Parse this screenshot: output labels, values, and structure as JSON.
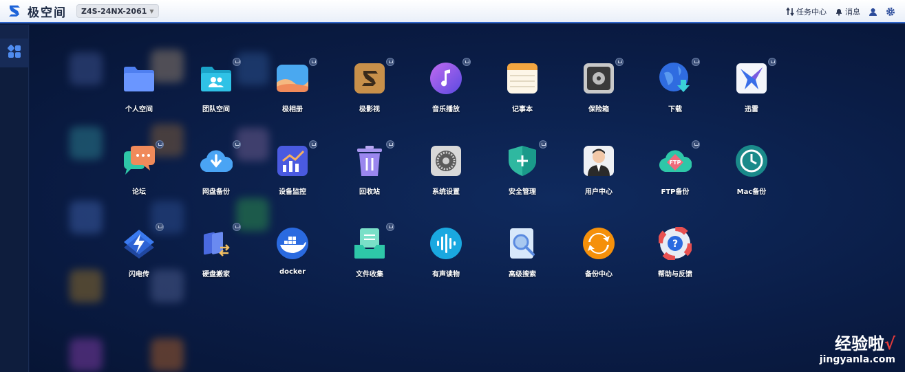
{
  "header": {
    "app_name": "极空间",
    "device": "Z4S-24NX-2061",
    "task_center": "任务中心",
    "messages": "消息"
  },
  "apps": [
    {
      "label": "个人空间",
      "icon": "folder-icon"
    },
    {
      "label": "团队空间",
      "icon": "team-folder-icon"
    },
    {
      "label": "极相册",
      "icon": "photo-album-icon"
    },
    {
      "label": "极影视",
      "icon": "video-icon"
    },
    {
      "label": "音乐播放",
      "icon": "music-note-icon"
    },
    {
      "label": "记事本",
      "icon": "notepad-icon"
    },
    {
      "label": "保险箱",
      "icon": "safe-icon"
    },
    {
      "label": "下载",
      "icon": "download-globe-icon"
    },
    {
      "label": "迅雷",
      "icon": "thunder-bird-icon"
    },
    {
      "label": "论坛",
      "icon": "forum-chat-icon"
    },
    {
      "label": "网盘备份",
      "icon": "cloud-download-icon"
    },
    {
      "label": "设备监控",
      "icon": "chart-monitor-icon"
    },
    {
      "label": "回收站",
      "icon": "trash-icon"
    },
    {
      "label": "系统设置",
      "icon": "gear-icon"
    },
    {
      "label": "安全管理",
      "icon": "shield-plus-icon"
    },
    {
      "label": "用户中心",
      "icon": "user-avatar-icon"
    },
    {
      "label": "FTP备份",
      "icon": "ftp-cloud-icon"
    },
    {
      "label": "Mac备份",
      "icon": "clock-backup-icon"
    },
    {
      "label": "闪电传",
      "icon": "lightning-icon"
    },
    {
      "label": "硬盘搬家",
      "icon": "disk-move-icon"
    },
    {
      "label": "docker",
      "icon": "docker-whale-icon"
    },
    {
      "label": "文件收集",
      "icon": "file-collect-icon"
    },
    {
      "label": "有声读物",
      "icon": "audio-wave-icon"
    },
    {
      "label": "高级搜索",
      "icon": "search-doc-icon"
    },
    {
      "label": "备份中心",
      "icon": "sync-icon"
    },
    {
      "label": "帮助与反馈",
      "icon": "help-lifebuoy-icon"
    }
  ],
  "watermark": {
    "text": "经验啦",
    "check": "√",
    "url": "jingyanla.com"
  }
}
